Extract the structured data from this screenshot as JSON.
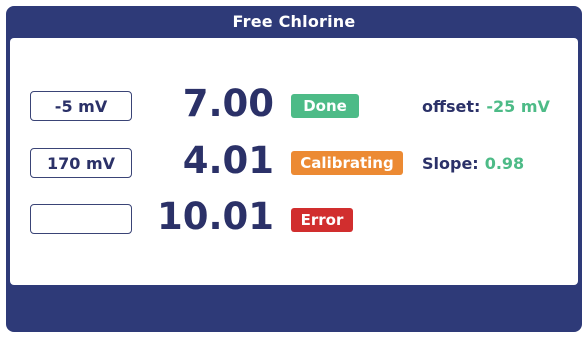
{
  "title": "Free Chlorine",
  "rows": [
    {
      "mv": "-5 mV",
      "ph": "7.00",
      "status": "Done",
      "status_color": "#4dbb87"
    },
    {
      "mv": "170 mV",
      "ph": "4.01",
      "status": "Calibrating",
      "status_color": "#ec8a33"
    },
    {
      "mv": "",
      "ph": "10.01",
      "status": "Error",
      "status_color": "#d12e2e"
    }
  ],
  "offset": {
    "label": "offset:",
    "value": "-25 mV"
  },
  "slope": {
    "label": "Slope:",
    "value": "0.98"
  },
  "colors": {
    "frame": "#2e3a78",
    "text": "#2b3168",
    "value_green": "#4dbb87"
  }
}
